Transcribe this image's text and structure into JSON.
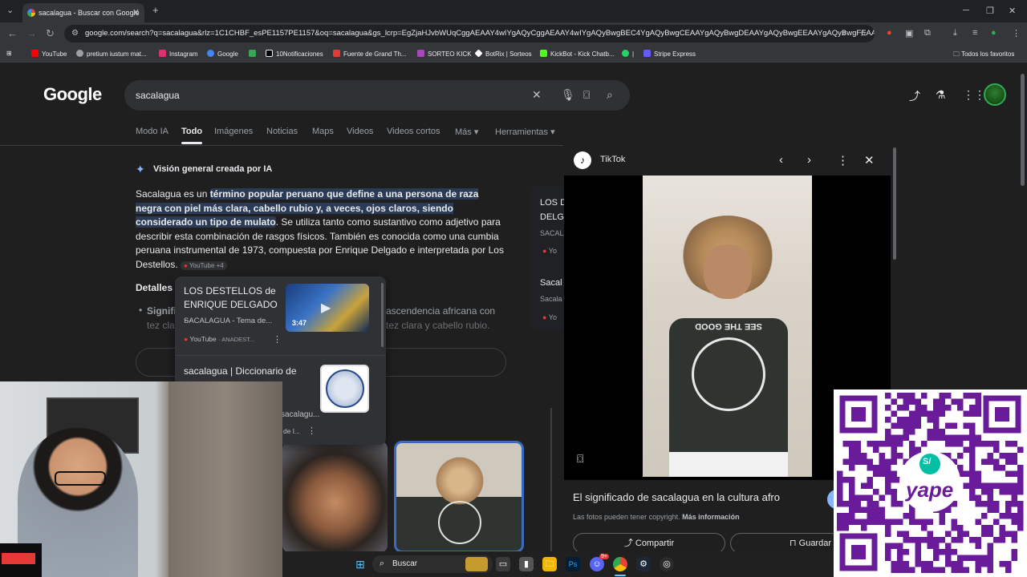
{
  "browser": {
    "tab_title": "sacalagua - Buscar con Google",
    "tab_close": "✕",
    "new_tab": "+",
    "url": "google.com/search?q=sacalagua&rlz=1C1CHBF_esPE1157PE1157&oq=sacalagua&gs_lcrp=EgZjaHJvbWUqCggAEAAY4wIYgAQyCggAEAAY4wIYgAQyBwgBEC4YgAQyBwgCEAAYgAQyBwgDEAAYgAQyBwgEEAAYgAQyBwgFEAAYg..."
  },
  "bookmarks": [
    {
      "label": "YouTube",
      "color": "#ff0000"
    },
    {
      "label": "pretium iustum mat...",
      "color": "#9aa0a6"
    },
    {
      "label": "Instagram",
      "color": "#e1306c"
    },
    {
      "label": "Google",
      "color": "#4285f4"
    },
    {
      "label": "",
      "color": "#34a853"
    },
    {
      "label": "10Notificaciones",
      "color": "#e8eaed"
    },
    {
      "label": "Fuente de Grand Th...",
      "color": "#e53935"
    },
    {
      "label": "SORTEO KICK",
      "color": "#ab47bc"
    },
    {
      "label": "BotRix | Sorteos",
      "color": "#ffffff"
    },
    {
      "label": "KickBot - Kick Chatb...",
      "color": "#53fc18"
    },
    {
      "label": "|",
      "color": "#25d366"
    },
    {
      "label": "Stripe Express",
      "color": "#635bff"
    }
  ],
  "bookmarks_all": "Todos los favoritos",
  "google": {
    "logo": "Google",
    "query": "sacalagua",
    "tabs": [
      "Modo IA",
      "Todo",
      "Imágenes",
      "Noticias",
      "Maps",
      "Videos",
      "Videos cortos",
      "Más",
      "Herramientas"
    ]
  },
  "ai_overview": {
    "title": "Visión general creada por IA",
    "text_a": "Sacalagua es un ",
    "text_hl": "término popular peruano que define a una persona de raza negra con piel más clara, cabello rubio y, a veces, ojos claros, siendo considerado un tipo de mulato",
    "text_b": ". Se utiliza tanto como sustantivo como adjetivo para describir esta combinación de rasgos físicos. También es conocida como una cumbia peruana instrumental de 1973, compuesta por Enrique Delgado e interpretada por Los Destellos.",
    "source_chip": "YouTube +4",
    "details_heading": "Detalles",
    "bullet_start": "Signifi",
    "bullet_line1_right": "ascendencia africana con",
    "bullet_line2_left": "tez cla",
    "bullet_line2_right": "tez clara y cabello rubio."
  },
  "right_sources": {
    "card1_title_a": "LOS D",
    "card1_title_b": "DELG",
    "card1_sub": "SACAL",
    "card1_src": "Yo",
    "card2_title": "Sacal",
    "card2_sub": "Sacala",
    "card2_src": "Yo"
  },
  "popup": {
    "item1_title": "LOS DESTELLOS de ENRIQUE DELGADO ...",
    "item1_sub": "SACALAGUA - Tema de...",
    "item1_source": "YouTube",
    "item1_source_extra": "· ANADEST...",
    "item1_duration": "3:47",
    "item2_title": "sacalagua | Diccionario de",
    "item2_sub": "sacalagu...",
    "item2_src": "de l..."
  },
  "tiktok_panel": {
    "source": "TikTok",
    "caption": "El significado de sacalagua en la cultura afro",
    "copyright": "Las fotos pueden tener copyright.",
    "more_info": "Más información",
    "share": "Compartir",
    "save": "Guardar",
    "shirt_text": "SEE THE GOOD"
  },
  "taskbar": {
    "search": "Buscar",
    "discord_badge": "9+"
  },
  "qr": {
    "brand": "yape",
    "currency": "S/"
  }
}
